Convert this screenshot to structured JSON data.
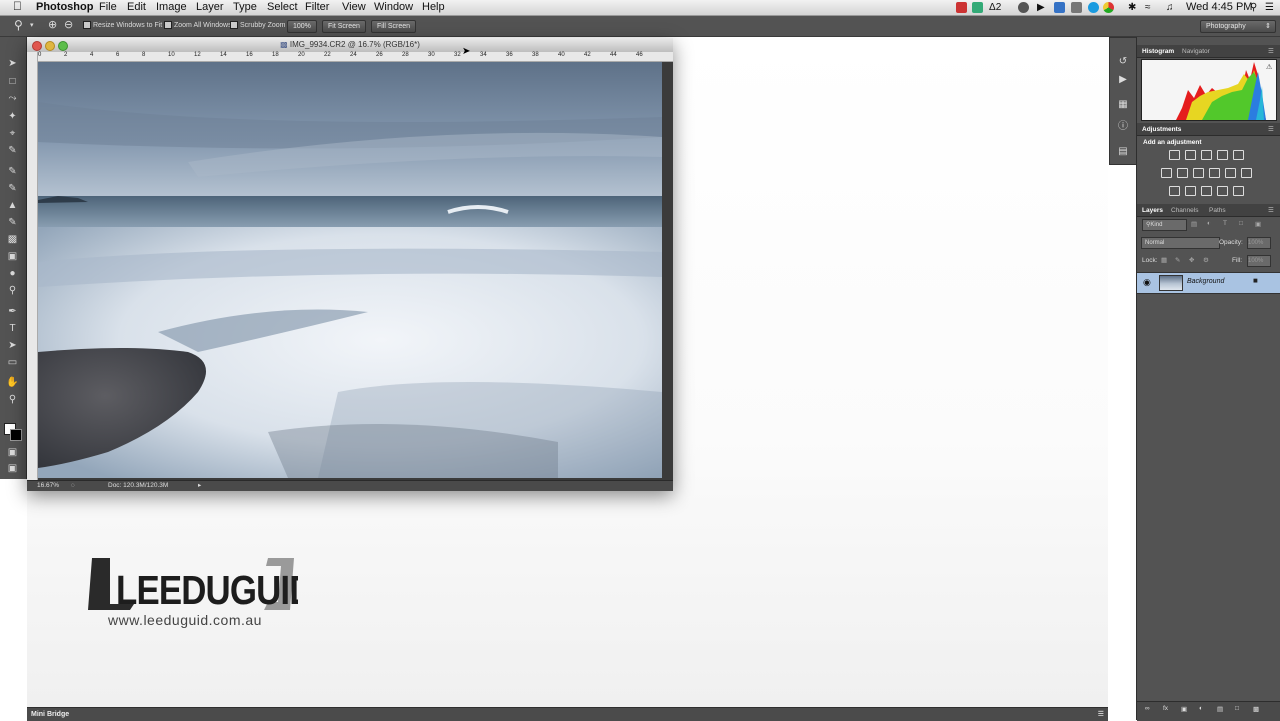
{
  "menubar": {
    "app_name": "Photoshop",
    "items": [
      "File",
      "Edit",
      "Image",
      "Layer",
      "Type",
      "Select",
      "Filter",
      "View",
      "Window",
      "Help"
    ],
    "status_icons": [
      "square-red-icon",
      "shield-icon",
      "adobe-badge-icon",
      "sync-icon",
      "play-icon",
      "save-icon",
      "dropbox-icon",
      "skype-icon",
      "record-icon",
      "chrome-icon",
      "time-machine-icon",
      "bluetooth-icon",
      "wifi-icon",
      "volume-icon"
    ],
    "adobe_badge": "2",
    "clock": "Wed 4:45 PM"
  },
  "options_bar": {
    "resize_windows": "Resize Windows to Fit",
    "zoom_all_windows": "Zoom All Windows",
    "scrubby_zoom": "Scrubby Zoom",
    "zoom_value": "100%",
    "fit_screen": "Fit Screen",
    "fill_screen": "Fill Screen",
    "workspace": "Photography"
  },
  "document": {
    "title": "IMG_9934.CR2 @ 16.7% (RGB/16*)",
    "ruler_labels": [
      "0",
      "2",
      "4",
      "6",
      "8",
      "10",
      "12",
      "14",
      "16",
      "18",
      "20",
      "22",
      "24",
      "26",
      "28",
      "30",
      "32",
      "34",
      "36",
      "38",
      "40",
      "42",
      "44",
      "46"
    ],
    "zoom": "16.67%",
    "doc_size": "Doc: 120.3M/120.3M"
  },
  "histogram_panel": {
    "tabs": [
      "Histogram",
      "Navigator"
    ]
  },
  "adjustments_panel": {
    "title": "Adjustments",
    "subtitle": "Add an adjustment"
  },
  "layers_panel": {
    "tabs": [
      "Layers",
      "Channels",
      "Paths"
    ],
    "kind": "Kind",
    "blend_mode": "Normal",
    "opacity_label": "Opacity:",
    "opacity_value": "100%",
    "lock_label": "Lock:",
    "fill_label": "Fill:",
    "fill_value": "100%",
    "layer_name": "Background"
  },
  "mini_bridge": {
    "label": "Mini Bridge"
  },
  "watermark": {
    "brand": "LEEDUGUID",
    "url": "www.leeduguid.com.au"
  },
  "colors": {
    "panel_bg": "#535353",
    "selected_layer": "#a9c3e2"
  }
}
